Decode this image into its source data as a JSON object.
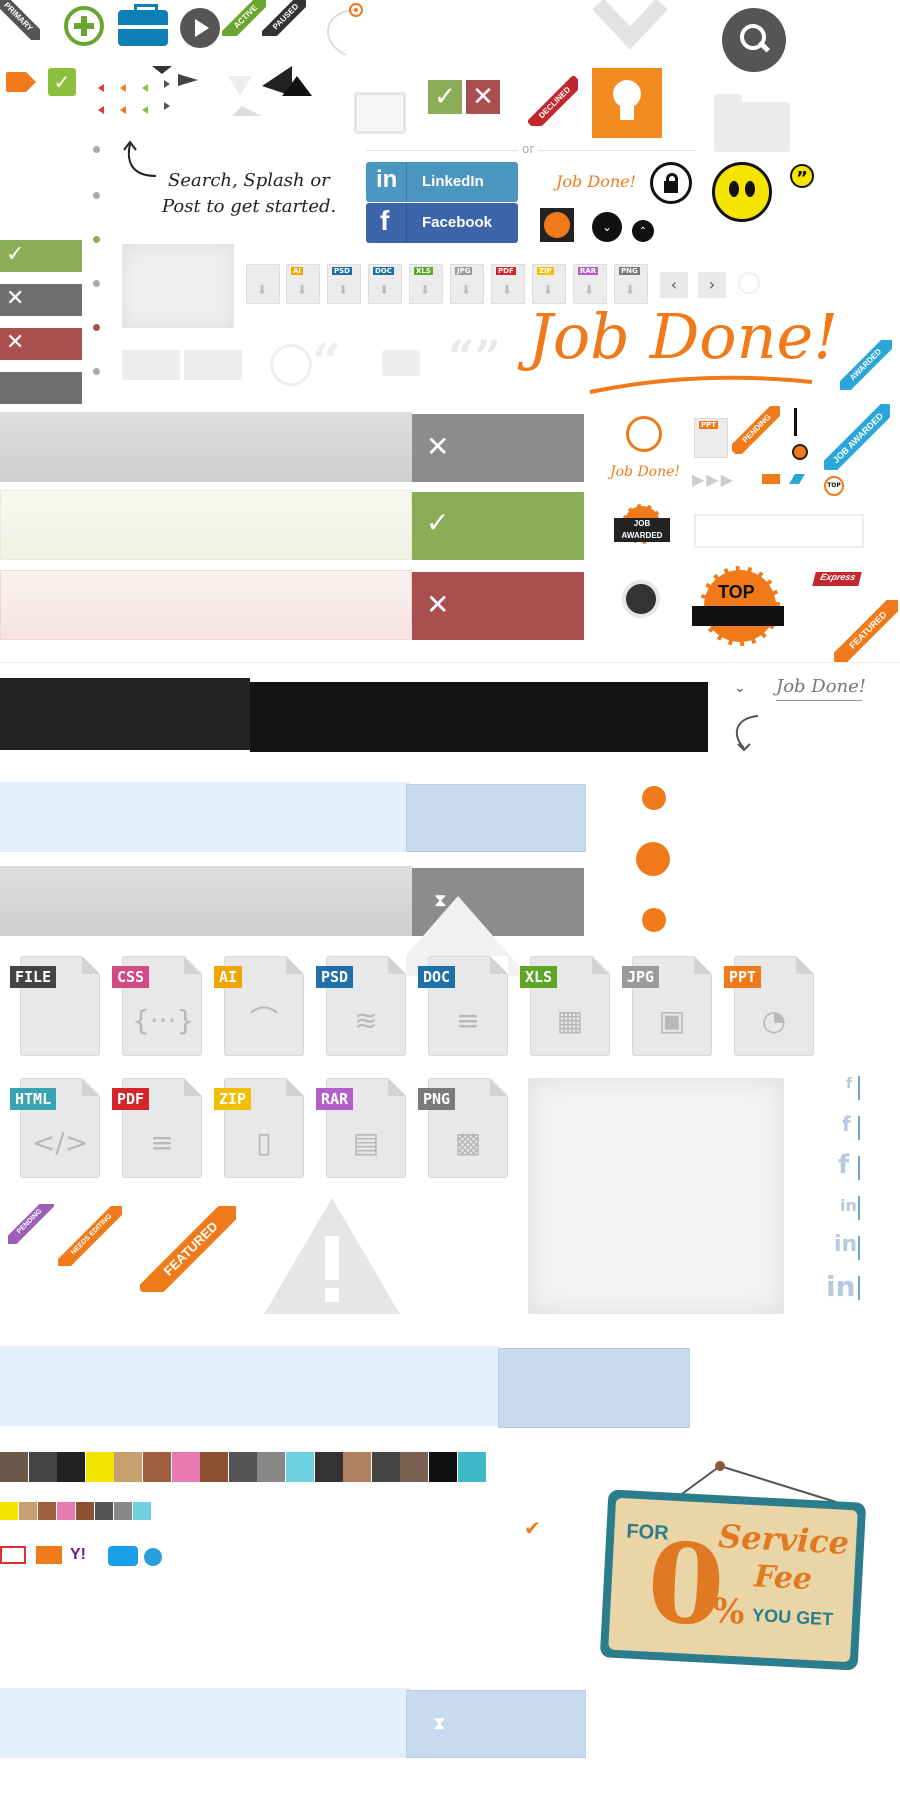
{
  "ribbons": {
    "primary": "PRIMARY",
    "active": "ACTIVE",
    "paused": "PAUSED",
    "declined": "DECLINED",
    "awarded": "AWARDED",
    "pending": "PENDING",
    "job_awarded": "JOB AWARDED",
    "featured": "FEATURED",
    "needs_editing": "NEEDS EDITING"
  },
  "callout": {
    "line1": "Search, Splash or",
    "line2": "Post to get started."
  },
  "separator_or": "or",
  "social": {
    "linkedin_label": "LinkedIn",
    "facebook_label": "Facebook",
    "linkedin_glyph": "in",
    "facebook_glyph": "f"
  },
  "job_done": {
    "small": "Job Done!",
    "big": "Job Done!",
    "medium": "Job Done!",
    "grey": "Job Done!"
  },
  "badges": {
    "job_awarded_line1": "JOB",
    "job_awarded_line2": "AWARDED",
    "top": "TOP",
    "top_small": "TOP",
    "express": "Express"
  },
  "file_types_small": [
    "AI",
    "PSD",
    "DOC",
    "XLS",
    "JPG",
    "PDF",
    "ZIP",
    "RAR",
    "PNG",
    "PPT"
  ],
  "file_icons_row1": [
    {
      "label": "FILE",
      "color": "#444444",
      "glyph": ""
    },
    {
      "label": "CSS",
      "color": "#d44a86",
      "glyph": "{···}"
    },
    {
      "label": "AI",
      "color": "#f0a500",
      "glyph": "⌒"
    },
    {
      "label": "PSD",
      "color": "#1f6fa8",
      "glyph": "≋"
    },
    {
      "label": "DOC",
      "color": "#1f6fa8",
      "glyph": "≡"
    },
    {
      "label": "XLS",
      "color": "#5fa52a",
      "glyph": "▦"
    },
    {
      "label": "JPG",
      "color": "#9a9a9a",
      "glyph": "▣"
    },
    {
      "label": "PPT",
      "color": "#f07a1a",
      "glyph": "◔"
    }
  ],
  "file_icons_row2": [
    {
      "label": "HTML",
      "color": "#3aa3b3",
      "glyph": "</>"
    },
    {
      "label": "PDF",
      "color": "#d4262a",
      "glyph": "≡"
    },
    {
      "label": "ZIP",
      "color": "#f0c000",
      "glyph": "▯"
    },
    {
      "label": "RAR",
      "color": "#b45ec8",
      "glyph": "▤"
    },
    {
      "label": "PNG",
      "color": "#7a7a7a",
      "glyph": "▩"
    }
  ],
  "sign": {
    "for": "FOR",
    "zero": "0",
    "percent": "%",
    "service": "Service",
    "fee": "Fee",
    "you_get": "YOU GET"
  },
  "colors": {
    "orange": "#f07a1a",
    "green": "#8cad57",
    "grey": "#8c8c8c",
    "red": "#a94f4f",
    "linkedin": "#4b96bf",
    "facebook": "#3b65a8",
    "light_blue": "#e3f0fb",
    "blue": "#c7daee",
    "black": "#141414"
  },
  "icons": {
    "search": "search-icon",
    "lock": "lock-icon",
    "bulb": "lightbulb-icon",
    "folder": "folder-icon",
    "check": "check-icon",
    "close": "close-icon",
    "hourglass": "hourglass-icon",
    "warning": "warning-icon",
    "quote": "quote-icon"
  }
}
